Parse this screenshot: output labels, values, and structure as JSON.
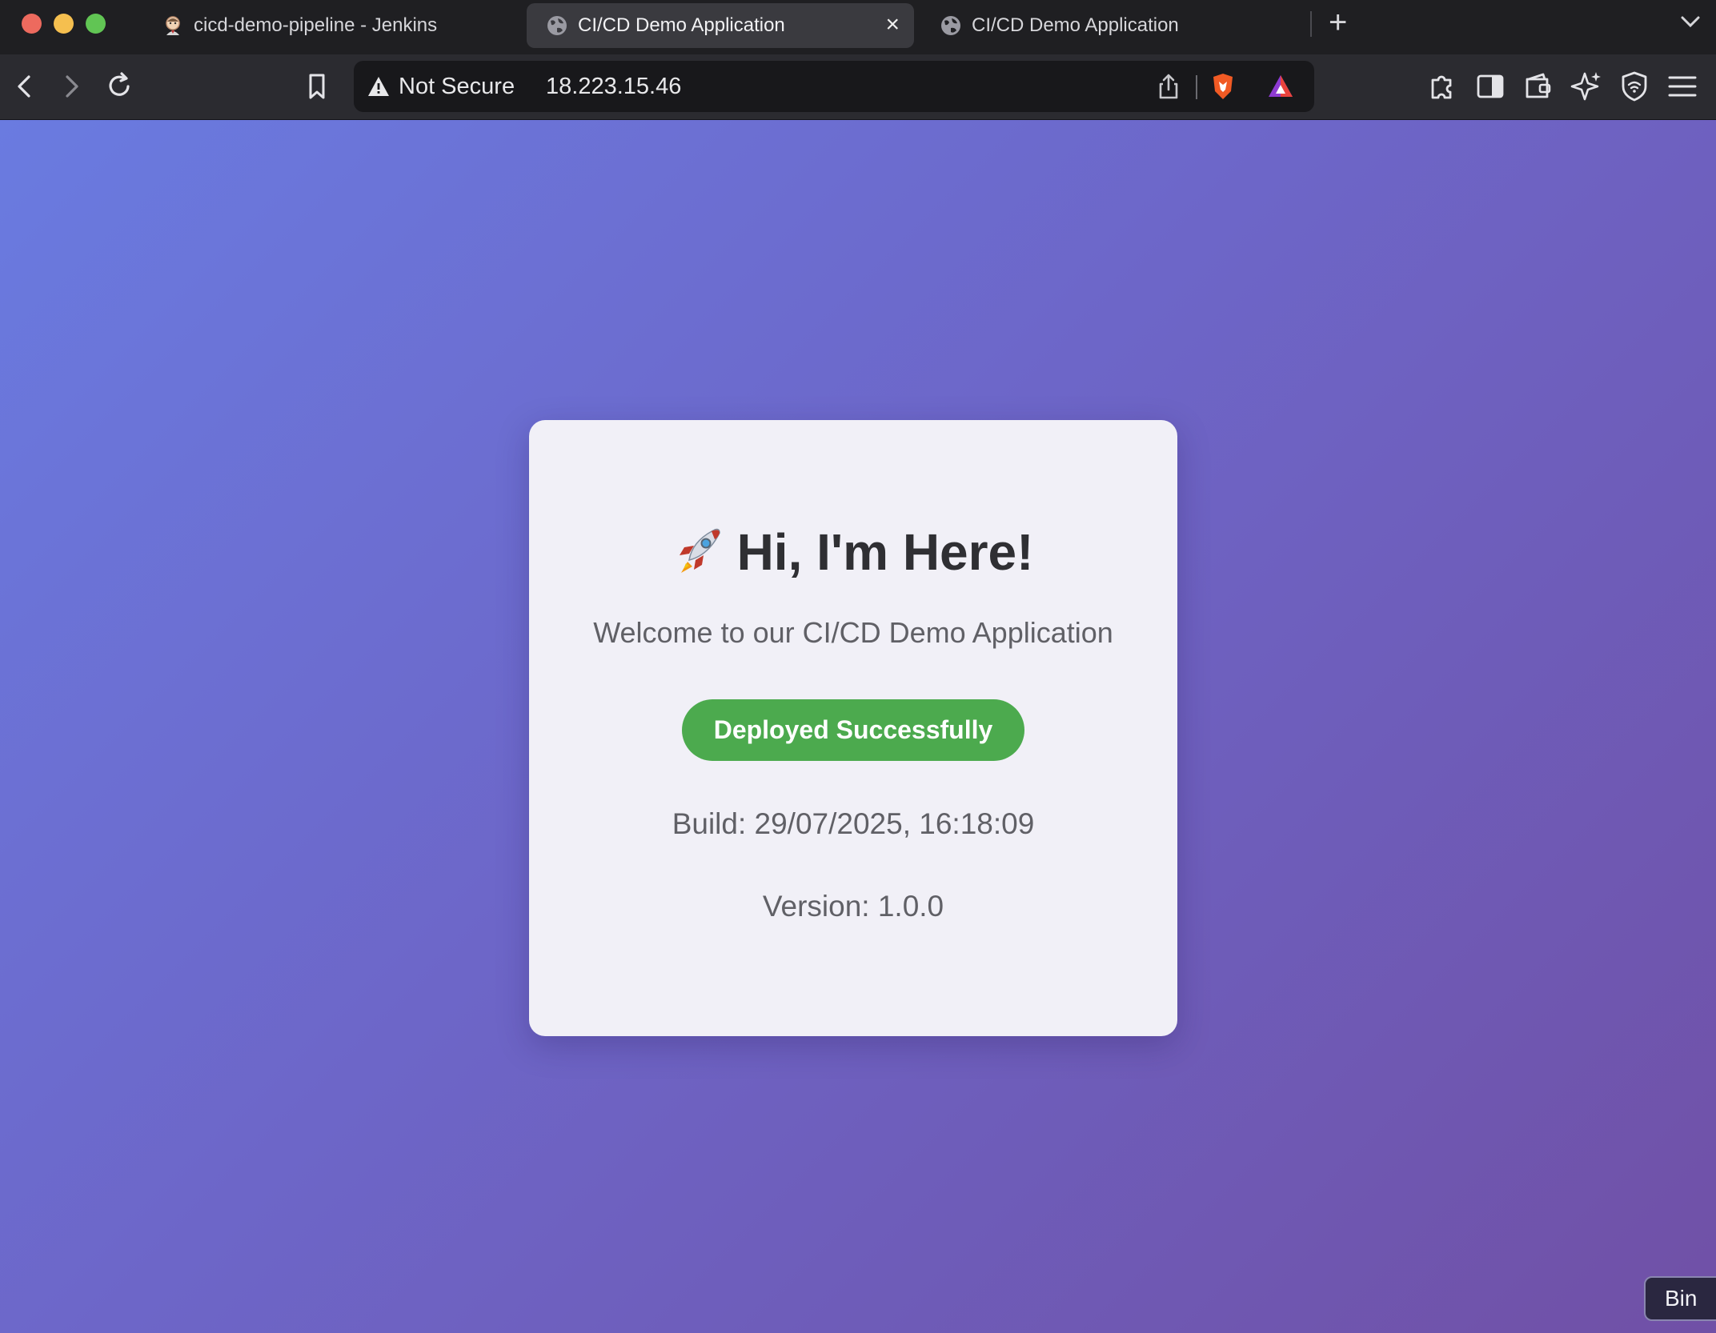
{
  "browser": {
    "tabs": [
      {
        "title": "cicd-demo-pipeline - Jenkins",
        "icon": "jenkins-icon",
        "active": false
      },
      {
        "title": "CI/CD Demo Application",
        "icon": "globe-icon",
        "active": true
      },
      {
        "title": "CI/CD Demo Application",
        "icon": "globe-icon",
        "active": false
      }
    ],
    "address_bar": {
      "security_label": "Not Secure",
      "url": "18.223.15.46"
    }
  },
  "page": {
    "title": "Hi, I'm Here!",
    "subtitle": "Welcome to our CI/CD Demo Application",
    "status": "Deployed Successfully",
    "build": "Build: 29/07/2025, 16:18:09",
    "version": "Version: 1.0.0"
  },
  "tooltip": "Bin",
  "colors": {
    "status_green": "#4caa4e",
    "gradient_start": "#6a7be0",
    "gradient_end": "#7050a6",
    "card_bg": "#f1f0f7"
  }
}
